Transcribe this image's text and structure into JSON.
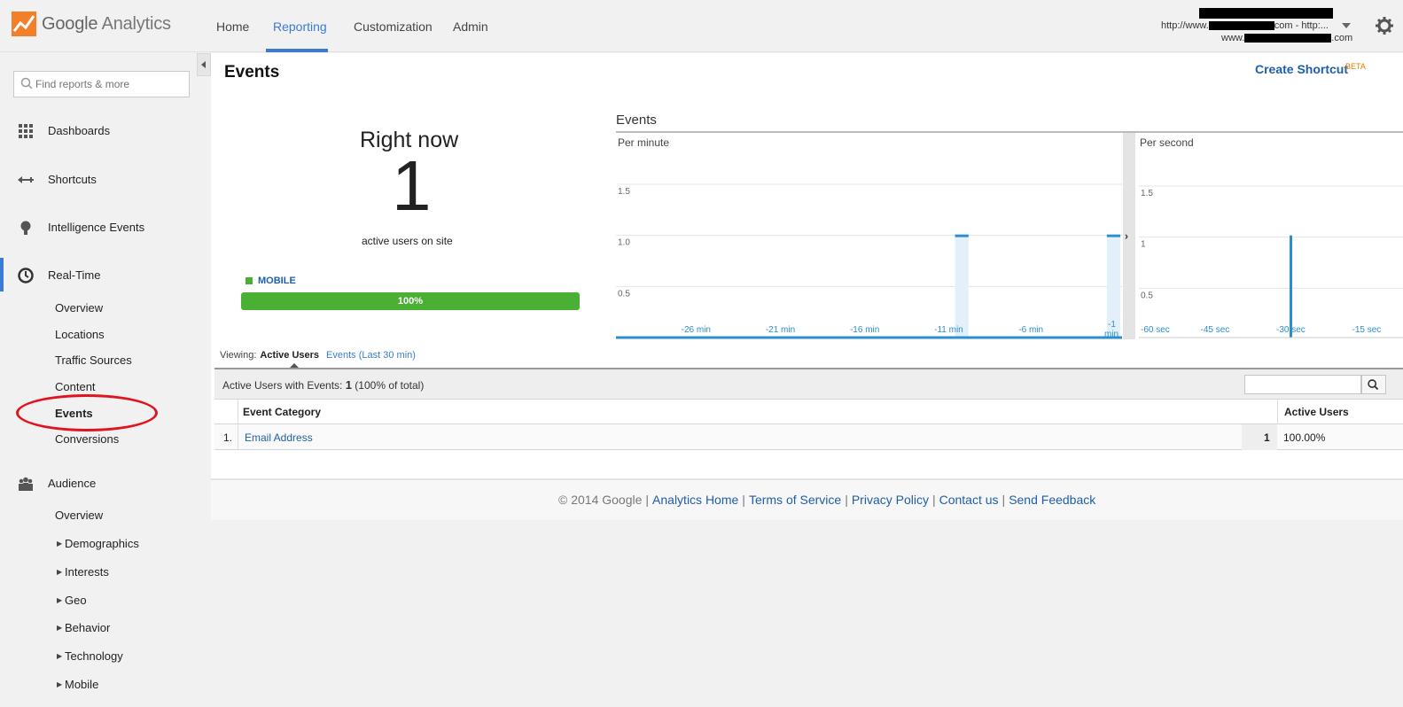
{
  "app": {
    "logo_google": "Google",
    "logo_analytics": "Analytics",
    "nav_tabs": [
      "Home",
      "Reporting",
      "Customization",
      "Admin"
    ],
    "active_tab": "Reporting",
    "account_line1": "http://www.",
    "account_line1_tail": "com - http:...",
    "account_line2": "www.",
    "account_line2_tail": ".com",
    "accent_color": "#3a7bd5"
  },
  "sidebar": {
    "search_placeholder": "Find reports & more",
    "sections": {
      "dashboards": "Dashboards",
      "shortcuts": "Shortcuts",
      "intelligence": "Intelligence Events",
      "realtime": "Real-Time",
      "audience": "Audience"
    },
    "realtime_items": [
      "Overview",
      "Locations",
      "Traffic Sources",
      "Content",
      "Events",
      "Conversions"
    ],
    "audience_items": [
      "Overview",
      "Demographics",
      "Interests",
      "Geo",
      "Behavior",
      "Technology",
      "Mobile"
    ]
  },
  "page": {
    "title": "Events",
    "create_shortcut": "Create Shortcut",
    "beta": "BETA",
    "right_now_label": "Right now",
    "right_now_value": "1",
    "right_now_sub": "active users on site",
    "device_label": "MOBILE",
    "device_pct": "100%",
    "device_color": "#4ab034"
  },
  "chart_data": {
    "type": "bar",
    "title": "Events",
    "panels": [
      {
        "name": "Per minute",
        "ylabels": [
          "1.5",
          "1.0",
          "0.5"
        ],
        "xlabels": [
          "-26 min",
          "-21 min",
          "-16 min",
          "-11 min",
          "-6 min",
          "-1 min"
        ],
        "ylim": [
          0,
          1.5
        ],
        "x": [
          -30,
          -29,
          -28,
          -27,
          -26,
          -25,
          -24,
          -23,
          -22,
          -21,
          -20,
          -19,
          -18,
          -17,
          -16,
          -15,
          -14,
          -13,
          -12,
          -11,
          -10,
          -9,
          -8,
          -7,
          -6,
          -5,
          -4,
          -3,
          -2,
          -1
        ],
        "values": [
          0,
          0,
          0,
          0,
          0,
          0,
          0,
          0,
          0,
          0,
          0,
          0,
          0,
          0,
          0,
          0,
          0,
          0,
          0,
          0,
          1,
          0,
          0,
          0,
          0,
          0,
          0,
          0,
          0,
          1
        ]
      },
      {
        "name": "Per second",
        "ylabels": [
          "1.5",
          "1",
          "0.5"
        ],
        "xlabels": [
          "-60 sec",
          "-45 sec",
          "-30 sec",
          "-15 sec"
        ],
        "ylim": [
          0,
          1.5
        ],
        "x": [
          -30
        ],
        "values": [
          1
        ]
      }
    ],
    "bar_color": "#2a8fd0"
  },
  "table": {
    "viewing_label": "Viewing:",
    "viewing_current": "Active Users",
    "viewing_alt": "Events (Last 30 min)",
    "summary_label": "Active Users with Events:",
    "summary_value": "1",
    "summary_pct": "(100% of total)",
    "col_category": "Event Category",
    "col_active": "Active Users",
    "rows": [
      {
        "index": "1.",
        "category": "Email Address",
        "value": "1",
        "pct": "100.00%"
      }
    ]
  },
  "footer": {
    "copyright": "© 2014 Google",
    "links": [
      "Analytics Home",
      "Terms of Service",
      "Privacy Policy",
      "Contact us",
      "Send Feedback"
    ]
  }
}
